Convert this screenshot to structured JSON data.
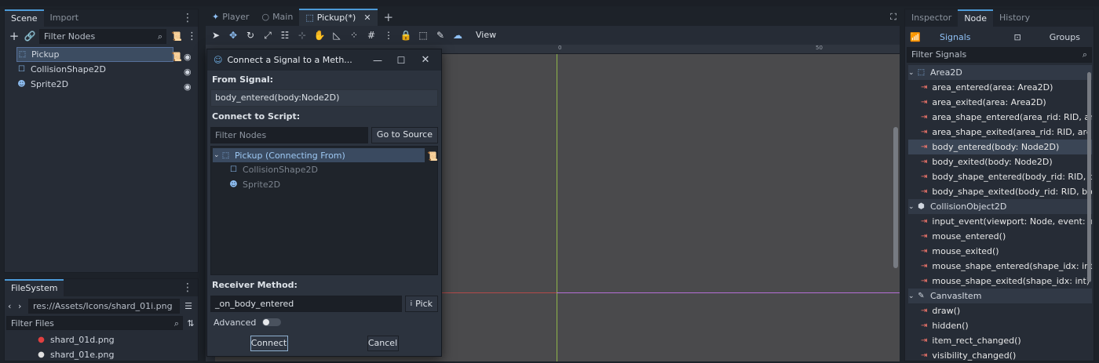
{
  "scene_panel": {
    "tabs": [
      "Scene",
      "Import"
    ],
    "filter_placeholder": "Filter Nodes",
    "nodes": [
      "Pickup",
      "CollisionShape2D",
      "Sprite2D"
    ]
  },
  "filesystem": {
    "tab": "FileSystem",
    "path": "res://Assets/Icons/shard_01i.png",
    "filter_placeholder": "Filter Files",
    "files": [
      "shard_01d.png",
      "shard_01e.png"
    ]
  },
  "editor_tabs": [
    "Player",
    "Main",
    "Pickup(*)"
  ],
  "toolbar": {
    "view_label": "View"
  },
  "ruler": {
    "ticks": [
      "0",
      "50"
    ]
  },
  "dialog": {
    "title": "Connect a Signal to a Meth...",
    "from_signal_label": "From Signal:",
    "from_signal_value": "body_entered(body:Node2D)",
    "connect_to_script_label": "Connect to Script:",
    "filter_placeholder": "Filter Nodes",
    "go_to_source": "Go to Source",
    "tree": [
      "Pickup (Connecting From)",
      "CollisionShape2D",
      "Sprite2D"
    ],
    "receiver_method_label": "Receiver Method:",
    "receiver_method_value": "_on_body_entered",
    "pick_label": "Pick",
    "advanced_label": "Advanced",
    "connect_button": "Connect",
    "cancel_button": "Cancel"
  },
  "right_panel": {
    "tabs": [
      "Inspector",
      "Node",
      "History"
    ],
    "subtabs": [
      "Signals",
      "Groups"
    ],
    "filter_placeholder": "Filter Signals",
    "groups": [
      {
        "name": "Area2D",
        "signals": [
          "area_entered(area: Area2D)",
          "area_exited(area: Area2D)",
          "area_shape_entered(area_rid: RID, ar...",
          "area_shape_exited(area_rid: RID, area...",
          "body_entered(body: Node2D)",
          "body_exited(body: Node2D)",
          "body_shape_entered(body_rid: RID, b...",
          "body_shape_exited(body_rid: RID, bo..."
        ]
      },
      {
        "name": "CollisionObject2D",
        "signals": [
          "input_event(viewport: Node, event: In...",
          "mouse_entered()",
          "mouse_exited()",
          "mouse_shape_entered(shape_idx: int)",
          "mouse_shape_exited(shape_idx: int)"
        ]
      },
      {
        "name": "CanvasItem",
        "signals": [
          "draw()",
          "hidden()",
          "item_rect_changed()",
          "visibility_changed()"
        ]
      }
    ]
  }
}
